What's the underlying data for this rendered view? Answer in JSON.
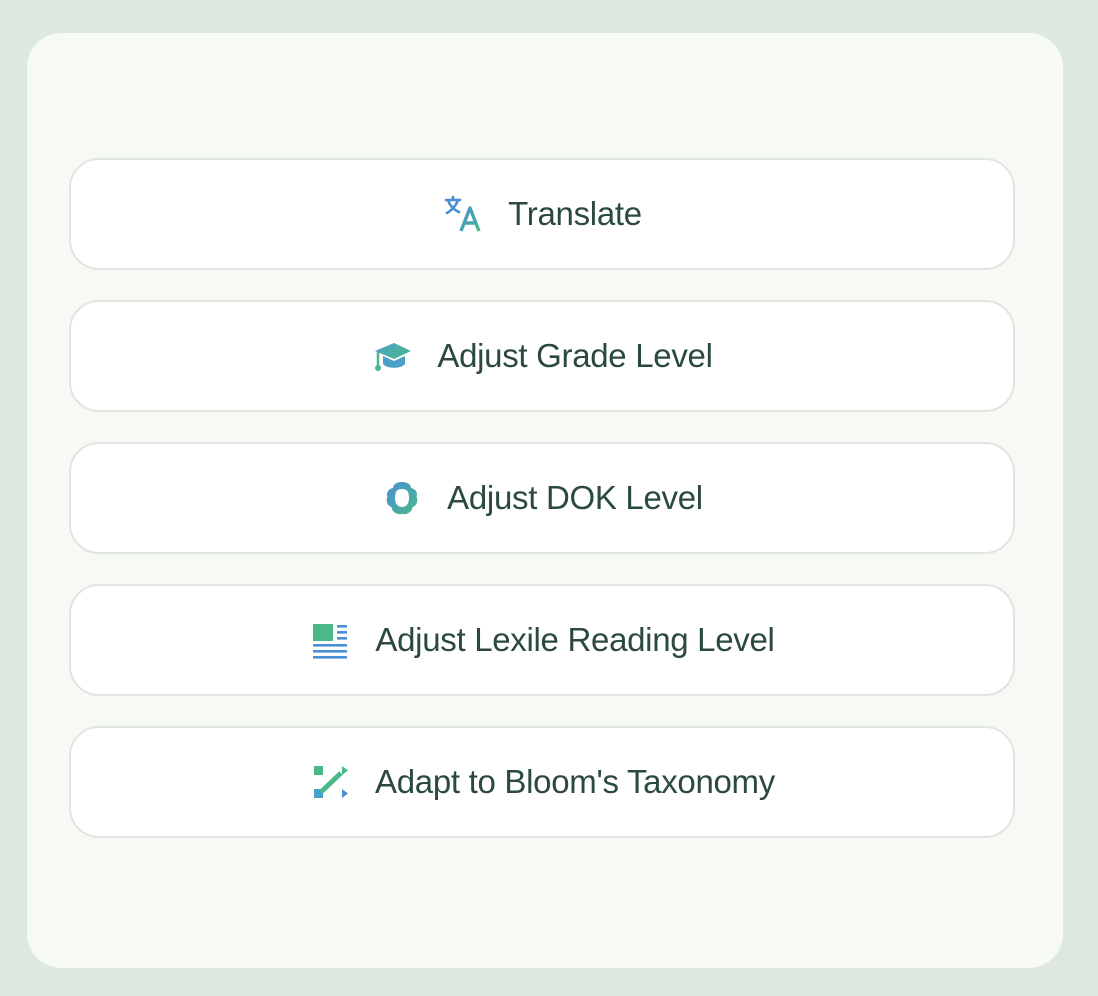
{
  "options": [
    {
      "label": "Translate",
      "icon": "translate-icon"
    },
    {
      "label": "Adjust Grade Level",
      "icon": "graduation-cap-icon"
    },
    {
      "label": "Adjust DOK Level",
      "icon": "brain-icon"
    },
    {
      "label": "Adjust Lexile Reading Level",
      "icon": "text-lines-icon"
    },
    {
      "label": "Adapt to Bloom's Taxonomy",
      "icon": "flow-arrows-icon"
    }
  ],
  "colors": {
    "background": "#dce8e0",
    "panel": "#f6f9f4",
    "text": "#2b4a3c",
    "icon_blue": "#4a8fd4",
    "icon_green": "#49b98a"
  }
}
